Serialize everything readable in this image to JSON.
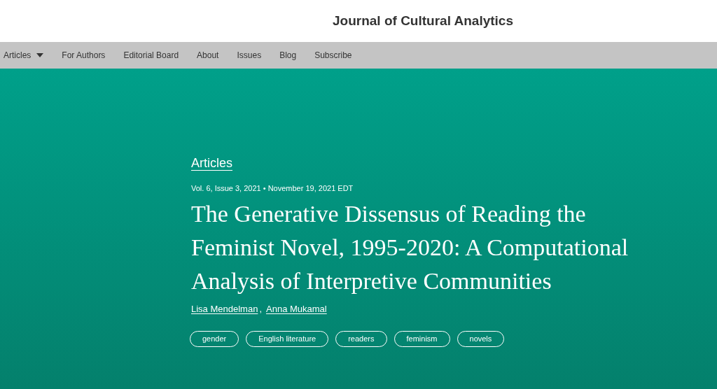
{
  "site_title": "Journal of Cultural Analytics",
  "nav": [
    {
      "label": "Articles",
      "kind": "dropdown"
    },
    {
      "label": "For Authors",
      "kind": "link"
    },
    {
      "label": "Editorial Board",
      "kind": "link"
    },
    {
      "label": "About",
      "kind": "link"
    },
    {
      "label": "Issues",
      "kind": "link"
    },
    {
      "label": "Blog",
      "kind": "link"
    },
    {
      "label": "Subscribe",
      "kind": "link"
    }
  ],
  "article": {
    "section": "Articles",
    "meta": "Vol. 6, Issue 3, 2021 • November 19, 2021 EDT",
    "title": "The Generative Dissensus of Reading the Feminist Novel, 1995-2020: A Computational Analysis of Interpretive Communities",
    "authors": [
      "Lisa Mendelman",
      "Anna Mukamal"
    ],
    "author_separator": ",",
    "tags": [
      "gender",
      "English literature",
      "readers",
      "feminism",
      "novels"
    ]
  }
}
